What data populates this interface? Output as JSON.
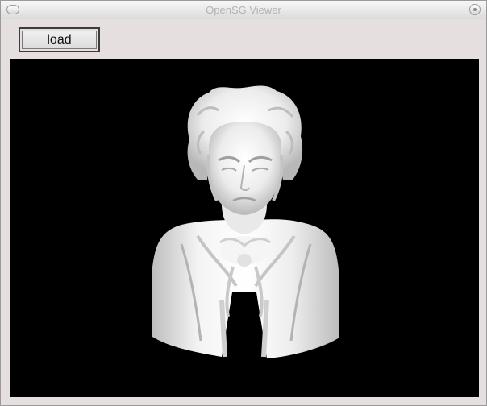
{
  "window": {
    "title": "OpenSG Viewer"
  },
  "toolbar": {
    "load_label": "load"
  },
  "viewport": {
    "background": "#000000",
    "model": "bust-statue"
  }
}
